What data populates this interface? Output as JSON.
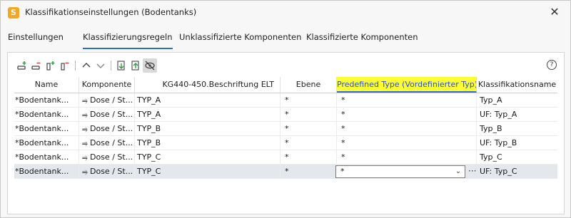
{
  "window": {
    "title": "Klassifikationseinstellungen (Bodentanks)",
    "app_icon_letter": "S",
    "close": "✕"
  },
  "tabs": [
    {
      "label": "Einstellungen",
      "active": false
    },
    {
      "label": "Klassifizierungsregeln",
      "active": true
    },
    {
      "label": "Unklassifizierte Komponenten",
      "active": false
    },
    {
      "label": "Klassifizierte Komponenten",
      "active": false
    }
  ],
  "toolbar": {
    "buttons": [
      "add-rule-icon",
      "remove-rule-icon",
      "add-condition-icon",
      "remove-condition-icon",
      "move-up-icon",
      "move-down-icon",
      "import-icon",
      "export-icon",
      "hide-icon"
    ],
    "help": "?"
  },
  "table": {
    "columns": [
      "Name",
      "Komponente",
      "KG440-450.Beschriftung ELT",
      "Ebene",
      "Predefined Type (Vordefinierter Typ)",
      "Klassifikationsname"
    ],
    "rows": [
      {
        "name": "*Bodentank...",
        "komponente": "Dose / St...",
        "beschriftung": "TYP_A",
        "ebene": "*",
        "predefined": "*",
        "klass": "Typ_A"
      },
      {
        "name": "*Bodentank...",
        "komponente": "Dose / St...",
        "beschriftung": "TYP_A",
        "ebene": "*",
        "predefined": "*",
        "klass": "UF: Typ_A"
      },
      {
        "name": "*Bodentank...",
        "komponente": "Dose / St...",
        "beschriftung": "TYP_B",
        "ebene": "*",
        "predefined": "*",
        "klass": "Typ_B"
      },
      {
        "name": "*Bodentank...",
        "komponente": "Dose / St...",
        "beschriftung": "TYP_B",
        "ebene": "*",
        "predefined": "*",
        "klass": "UF: Typ_B"
      },
      {
        "name": "*Bodentank...",
        "komponente": "Dose / St...",
        "beschriftung": "TYP_C",
        "ebene": "*",
        "predefined": "*",
        "klass": "Typ_C"
      },
      {
        "name": "*Bodentank...",
        "komponente": "Dose / St...",
        "beschriftung": "TYP_C",
        "ebene": "*",
        "predefined": "*",
        "klass": "UF: Typ_C"
      }
    ],
    "selected_row": 5,
    "plug_glyph": "⥤",
    "more": "···",
    "chevron": "⌄"
  },
  "colors": {
    "accent": "#2a6fc9",
    "highlight": "#ffff33",
    "selected_row": "#e4e7ec"
  }
}
